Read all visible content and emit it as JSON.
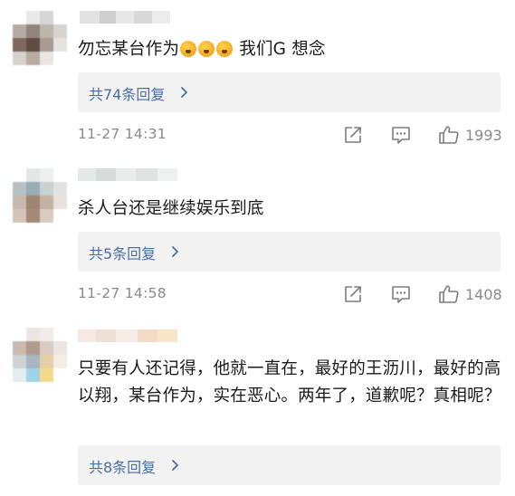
{
  "comments": [
    {
      "text": "勿忘某台作为",
      "text_suffix": " 我们G 想念",
      "emoji_names": [
        "angry-face-icon",
        "angry-face-icon",
        "angry-face-icon"
      ],
      "reply_label": "共74条回复",
      "time": "11-27 14:31",
      "likes": "1993"
    },
    {
      "text": "杀人台还是继续娱乐到底",
      "reply_label": "共5条回复",
      "time": "11-27 14:58",
      "likes": "1408"
    },
    {
      "text": "只要有人还记得，他就一直在，最好的王沥川，最好的高以翔，某台作为，实在恶心。两年了，道歉呢？真相呢？",
      "reply_label": "共8条回复"
    }
  ],
  "colors": {
    "link": "#4a6fa5",
    "meta": "#8a8a8a",
    "reply_bg": "#f2f2f2",
    "icon": "#7d7d7d"
  }
}
